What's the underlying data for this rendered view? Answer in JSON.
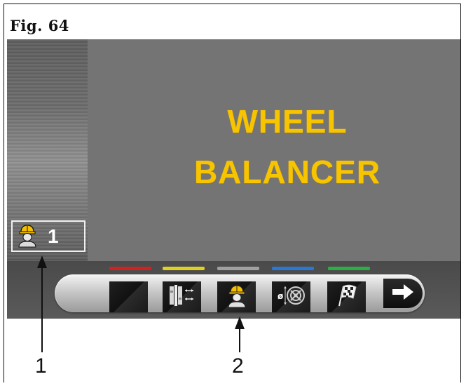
{
  "figure": {
    "title": "Fig. 64"
  },
  "screen": {
    "title_line1": "WHEEL",
    "title_line2": "BALANCER",
    "user_badge": {
      "icon": "operator-icon",
      "number": "1"
    }
  },
  "toolbar": {
    "color_strips": [
      {
        "name": "red",
        "color": "#d42020"
      },
      {
        "name": "yellow",
        "color": "#e0d020"
      },
      {
        "name": "gray",
        "color": "#a0a0a0"
      },
      {
        "name": "blue",
        "color": "#2878d8"
      },
      {
        "name": "green",
        "color": "#28b040"
      }
    ],
    "buttons": [
      {
        "icon": "blank-icon"
      },
      {
        "icon": "balancing-program-icon"
      },
      {
        "icon": "operator-icon"
      },
      {
        "icon": "wheel-dimensions-icon",
        "label": "ø"
      },
      {
        "icon": "checkered-flag-icon"
      },
      {
        "icon": "arrow-right-icon"
      }
    ]
  },
  "callouts": {
    "label_1": "1",
    "label_2": "2"
  },
  "colors": {
    "accent_yellow": "#f7c400",
    "screen_bg": "#747474",
    "toolbar_bg": "#4f4f4f"
  }
}
